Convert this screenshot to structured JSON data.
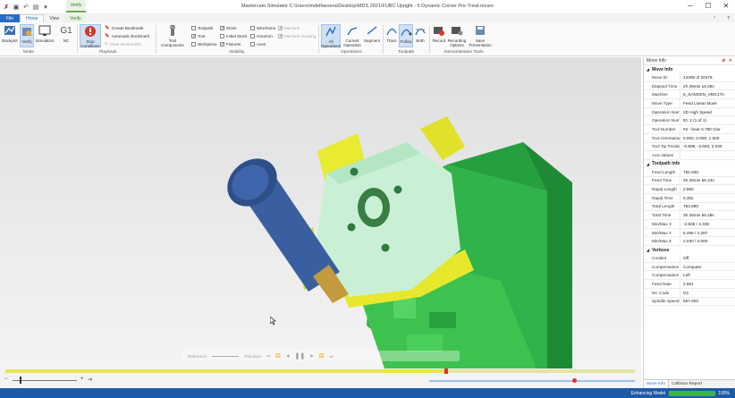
{
  "window": {
    "title": "Mastercam Simulator  C:\\Users\\mdelfaesera\\Desktop\\MDS 2021\\FUBC Upright - 5 Dynamic Corner Pre-Treat.mcam",
    "context_tab": "Verify",
    "minimize": "─",
    "maximize": "☐",
    "close": "✕"
  },
  "tabs": [
    "File",
    "Home",
    "View",
    "Verify"
  ],
  "ribbon": {
    "backplot": "Backplot",
    "verify": "Verify",
    "simulation": "Simulation",
    "nc": "NC",
    "stop_conditions": "Stop Conditions",
    "create_bookmark": "Create Bookmark",
    "automatic_bookmark": "Automatic Bookmark",
    "clear_bookmarks": "Clear Bookmarks",
    "tool_components": "Tool Components",
    "toolpath_chk": "Toolpath",
    "tool_chk": "Tool",
    "workpiece_chk": "Workpiece",
    "stock_chk": "Stock",
    "initial_stock_chk": "Initial Stock",
    "fixtures_chk": "Fixtures",
    "wireframe_chk": "Wireframe",
    "gnomon_chk": "Gnomon",
    "axes_chk": "Axes",
    "machine_chk": "Machine",
    "machine_housing_chk": "Machine Housing",
    "all_operations": "All Operations",
    "current_operation": "Current Operation",
    "segment": "Segment",
    "trace": "Trace",
    "follow": "Follow",
    "both": "Both",
    "record": "Record",
    "recording_options": "Recording Options",
    "save_presentation": "Save Presentation",
    "groups": [
      "Mode",
      "Playback",
      "Visibility",
      "Operations",
      "Toolpath",
      "Demonstration Tools"
    ]
  },
  "playback": {
    "reference": "Reference",
    "precision": "Precision",
    "progress": 0.7
  },
  "status": {
    "enhancing": "Enhancing Model",
    "percent": "100%",
    "fill": 1.0
  },
  "panel": {
    "title": "Move Info",
    "sections": [
      {
        "name": "Move Info",
        "rows": [
          [
            "Move ID",
            "14306 of 20476"
          ],
          [
            "Elapsed Time",
            "2h 26min 16.28s"
          ],
          [
            "Machine",
            "5_SANGEN_VMC1TA"
          ],
          [
            "Move Type",
            "Feed Linear Move"
          ],
          [
            "Operation Name",
            "2D High Speed"
          ],
          [
            "Operation Numb",
            "ID: 2 (1 of 1)"
          ],
          [
            "Tool Number",
            "#2 - bear 0.750 Clur"
          ],
          [
            "Tool Orientation",
            "0.000, 0.000, 1.000"
          ],
          [
            "Tool Tip Position",
            "-0.599, -3.693, 2.030"
          ],
          [
            "Axis Values",
            ""
          ]
        ]
      },
      {
        "name": "Toolpath Info",
        "rows": [
          [
            "Feed Length",
            "781.930"
          ],
          [
            "Feed Time",
            "3h 26min 56.43s"
          ],
          [
            "Rapid Length",
            "2.960"
          ],
          [
            "Rapid Time",
            "0.30s"
          ],
          [
            "Total Length",
            "784.890"
          ],
          [
            "Total Time",
            "3h 26min 56.48s"
          ],
          [
            "Min/Max X",
            "-3.848 / 4.338"
          ],
          [
            "Min/Max Y",
            "5.496 / 4.287"
          ],
          [
            "Min/Max Z",
            "2.030 / 4.000"
          ]
        ]
      },
      {
        "name": "Verbose",
        "rows": [
          [
            "Coolant",
            "Off"
          ],
          [
            "Compensation T",
            "Computer"
          ],
          [
            "Compensation D",
            "Left"
          ],
          [
            "Feed Rate",
            "2.501"
          ],
          [
            "NC Code",
            "G1"
          ],
          [
            "Spindle Speed",
            "667.000"
          ]
        ]
      }
    ],
    "tabs": [
      "Move Info",
      "Collision Report"
    ]
  },
  "colors": {
    "accent": "#2a6cc4",
    "status_bar": "#1f5aa6",
    "part_green": "#3ec24f",
    "part_yellow": "#e7e82c",
    "tool_blue": "#3a5fa0",
    "fixture_mint": "#c9f0d5"
  },
  "icons": {
    "pin": "📌",
    "close": "✕"
  }
}
